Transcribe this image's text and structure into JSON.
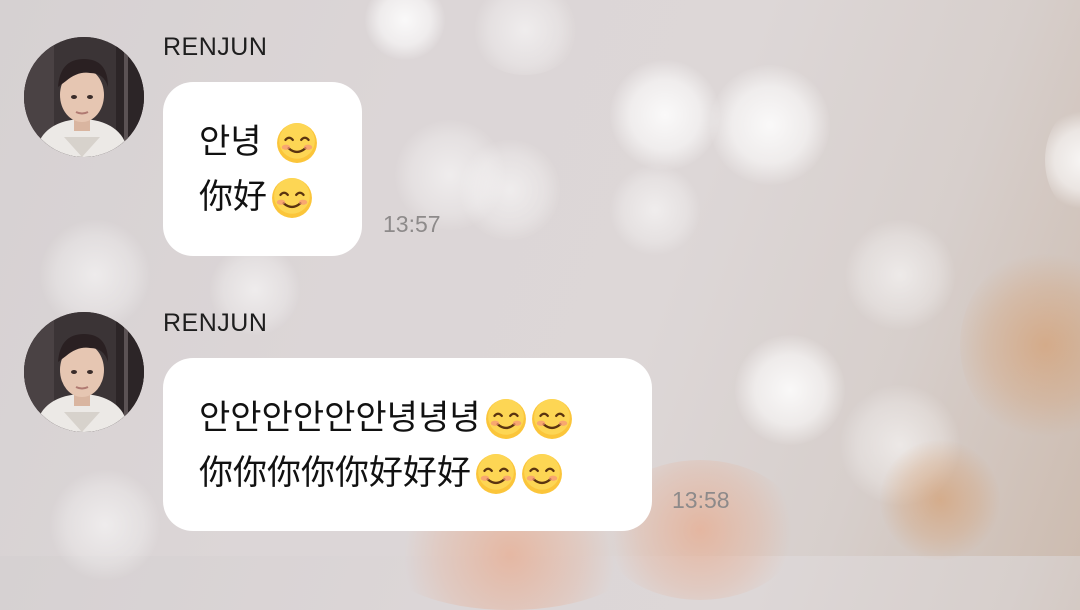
{
  "messages": [
    {
      "sender": "RENJUN",
      "lines": [
        {
          "text": "안녕",
          "emojis": [
            "smiling-face-icon"
          ]
        },
        {
          "text": "你好",
          "emojis": [
            "smiling-face-icon"
          ]
        }
      ],
      "time": "13:57"
    },
    {
      "sender": "RENJUN",
      "lines": [
        {
          "text": "안안안안안안녕녕녕",
          "emojis": [
            "smiling-face-icon",
            "smiling-face-icon"
          ]
        },
        {
          "text": "你你你你你好好好",
          "emojis": [
            "smiling-face-icon",
            "smiling-face-icon"
          ]
        }
      ],
      "time": "13:58"
    }
  ],
  "colors": {
    "bubble": "#ffffff",
    "timestamp": "#8d8a8a",
    "sender": "#1e1e1e"
  }
}
